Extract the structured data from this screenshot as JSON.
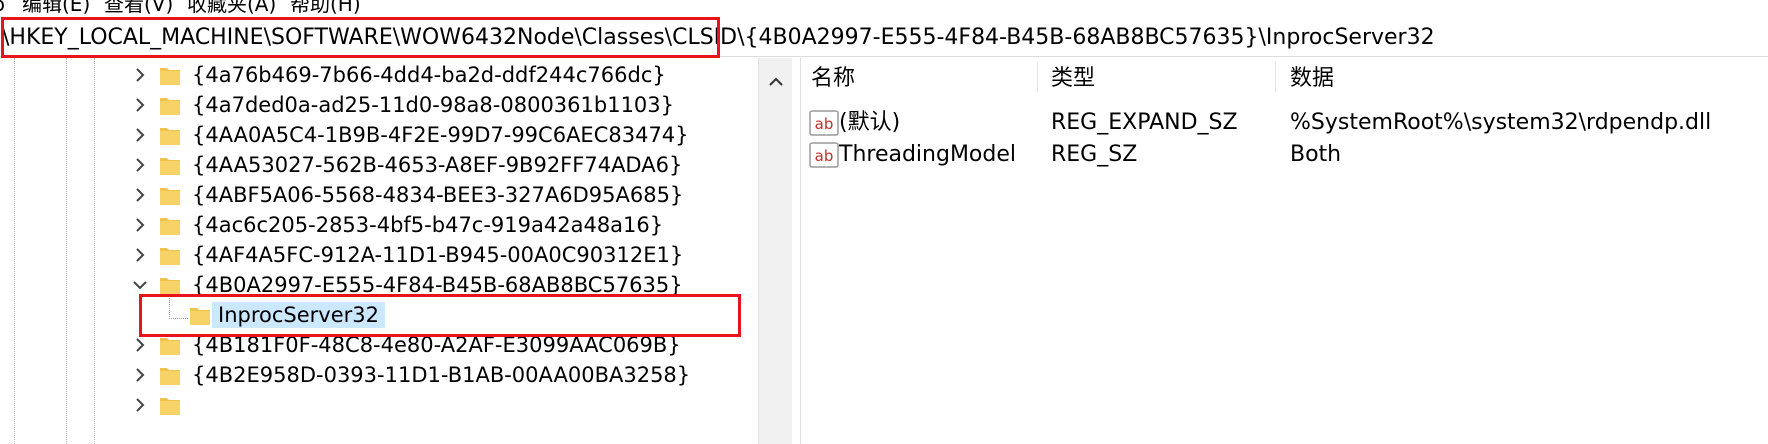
{
  "menu": {
    "items": [
      {
        "label": "ɔ"
      },
      {
        "label": "编辑(E)"
      },
      {
        "label": "查看(V)"
      },
      {
        "label": "收藏夹(A)"
      },
      {
        "label": "帮助(H)"
      }
    ]
  },
  "address": {
    "path": "\\HKEY_LOCAL_MACHINE\\SOFTWARE\\WOW6432Node\\Classes\\CLSID\\{4B0A2997-E555-4F84-B45B-68AB8BC57635}\\InprocServer32"
  },
  "tree": {
    "items": [
      {
        "label": "{4a76b469-7b66-4dd4-ba2d-ddf244c766dc}",
        "expanded": false
      },
      {
        "label": "{4a7ded0a-ad25-11d0-98a8-0800361b1103}",
        "expanded": false
      },
      {
        "label": "{4AA0A5C4-1B9B-4F2E-99D7-99C6AEC83474}",
        "expanded": false
      },
      {
        "label": "{4AA53027-562B-4653-A8EF-9B92FF74ADA6}",
        "expanded": false
      },
      {
        "label": "{4ABF5A06-5568-4834-BEE3-327A6D95A685}",
        "expanded": false
      },
      {
        "label": "{4ac6c205-2853-4bf5-b47c-919a42a48a16}",
        "expanded": false
      },
      {
        "label": "{4AF4A5FC-912A-11D1-B945-00A0C90312E1}",
        "expanded": false
      },
      {
        "label": "{4B0A2997-E555-4F84-B45B-68AB8BC57635}",
        "expanded": true
      },
      {
        "label": "InprocServer32",
        "selected": true
      },
      {
        "label": "{4B181F0F-48C8-4e80-A2AF-E3099AAC069B}",
        "expanded": false
      },
      {
        "label": "{4B2E958D-0393-11D1-B1AB-00AA00BA3258}",
        "expanded": false
      }
    ]
  },
  "values": {
    "headers": {
      "name": "名称",
      "type": "类型",
      "data": "数据"
    },
    "rows": [
      {
        "name": "(默认)",
        "type": "REG_EXPAND_SZ",
        "data": "%SystemRoot%\\system32\\rdpendp.dll",
        "icon": "string-value-icon"
      },
      {
        "name": "ThreadingModel",
        "type": "REG_SZ",
        "data": "Both",
        "icon": "string-value-icon"
      }
    ]
  },
  "colors": {
    "highlight": "#e8141c",
    "selection": "#cce8ff",
    "folder": "#f0c44c"
  }
}
